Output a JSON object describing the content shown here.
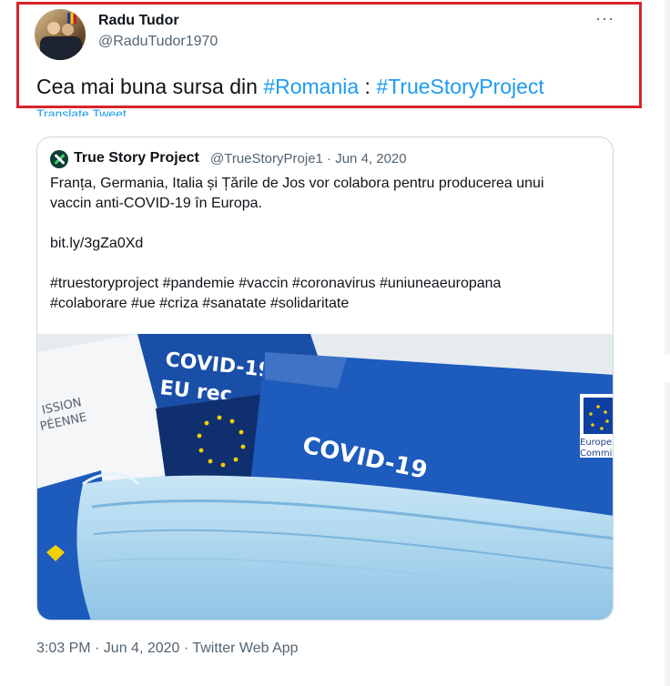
{
  "author": {
    "name": "Radu Tudor",
    "handle": "@RaduTudor1970"
  },
  "tweet": {
    "text_main": "Cea mai buna sursa din ",
    "hashtag1": "#Romania",
    "separator": " : ",
    "hashtag2": "#TrueStoryProject"
  },
  "translate_label": "Translate Tweet",
  "more_label": "···",
  "quoted": {
    "name": "True Story Project",
    "meta": "@TrueStoryProje1 · Jun 4, 2020",
    "line1": "Franța, Germania, Italia și Țările de Jos vor colabora pentru producerea unui",
    "line2": "vaccin anti-COVID-19 în Europa.",
    "link": "bit.ly/3gZa0Xd",
    "tags1": "#truestoryproject #pandemie #vaccin #coronavirus #uniuneaeuropana",
    "tags2": "#colaborare #ue #criza #sanatate #solidaritate",
    "image_texts": {
      "covid_top": "COVID-19",
      "eu_rec": "EU rec",
      "commission": "ISSION",
      "europeenne": "PÉENNE",
      "covid_main": "COVID-19",
      "european": "Europea",
      "commis": "Commiss"
    }
  },
  "timestamp": "3:03 PM · Jun 4, 2020 · Twitter Web App",
  "colors": {
    "accent": "#1d9bf0",
    "highlight": "#d8232a",
    "eu_blue": "#1a4fa8",
    "eu_star": "#f4d000"
  }
}
